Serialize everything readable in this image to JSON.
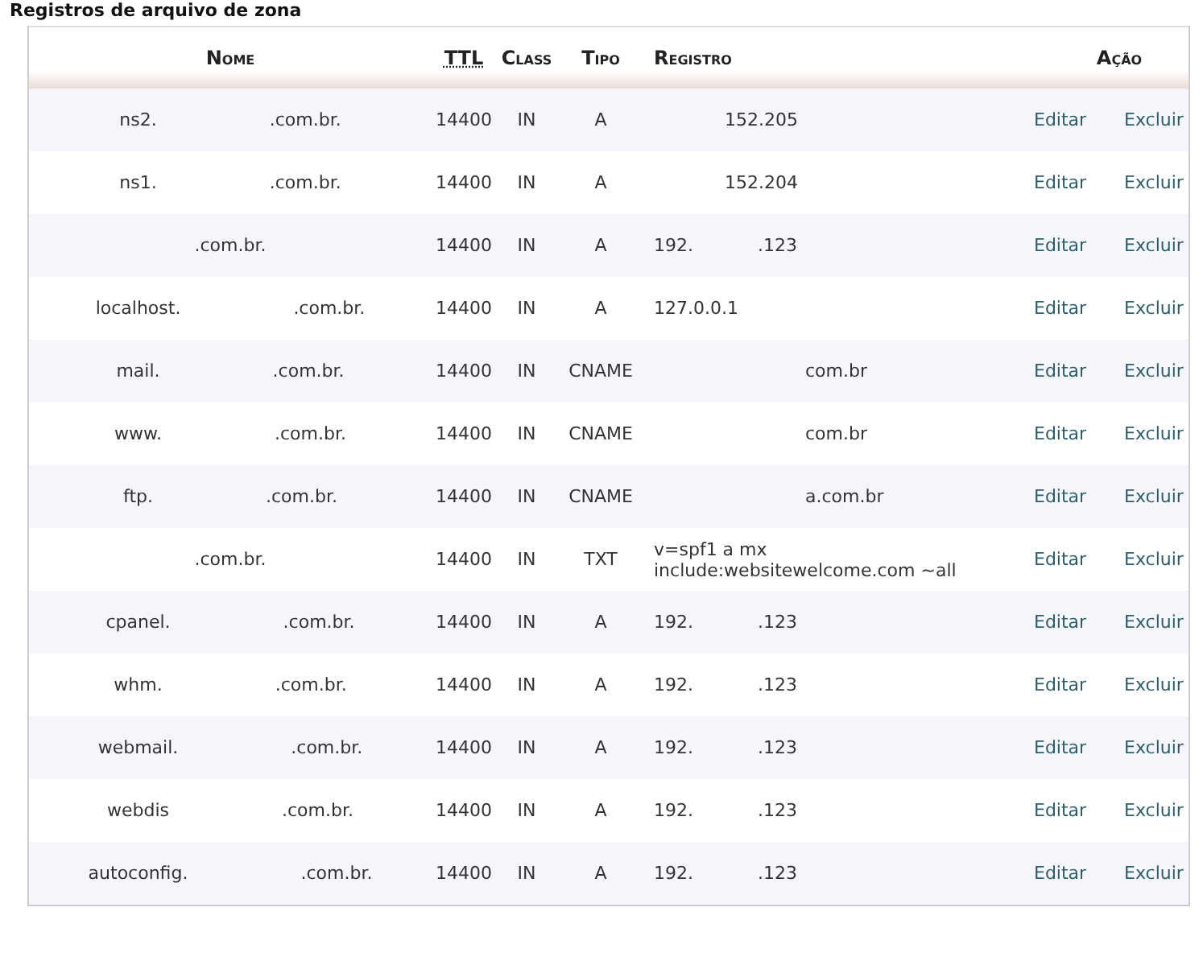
{
  "title": "Registros de arquivo de zona",
  "columns": [
    "Nome",
    "TTL",
    "Class",
    "Tipo",
    "Registro",
    "Ação"
  ],
  "rows": [
    {
      "name": [
        "ns2.",
        ".com.br."
      ],
      "ttl": "14400",
      "class": "IN",
      "type": "A",
      "record": [
        "152.205"
      ],
      "actions": [
        "Editar",
        "Excluir"
      ]
    },
    {
      "name": [
        "ns1.",
        ".com.br."
      ],
      "ttl": "14400",
      "class": "IN",
      "type": "A",
      "record": [
        "152.204"
      ],
      "actions": [
        "Editar",
        "Excluir"
      ]
    },
    {
      "name": [
        ".com.br."
      ],
      "ttl": "14400",
      "class": "IN",
      "type": "A",
      "record": [
        "192.",
        ".123"
      ],
      "actions": [
        "Editar",
        "Excluir"
      ]
    },
    {
      "name": [
        "localhost.",
        ".com.br."
      ],
      "ttl": "14400",
      "class": "IN",
      "type": "A",
      "record": [
        "127.0.0.1"
      ],
      "actions": [
        "Editar",
        "Excluir"
      ]
    },
    {
      "name": [
        "mail.",
        ".com.br."
      ],
      "ttl": "14400",
      "class": "IN",
      "type": "CNAME",
      "record": [
        "com.br"
      ],
      "actions": [
        "Editar",
        "Excluir"
      ]
    },
    {
      "name": [
        "www.",
        ".com.br."
      ],
      "ttl": "14400",
      "class": "IN",
      "type": "CNAME",
      "record": [
        "com.br"
      ],
      "actions": [
        "Editar",
        "Excluir"
      ]
    },
    {
      "name": [
        "ftp.",
        ".com.br."
      ],
      "ttl": "14400",
      "class": "IN",
      "type": "CNAME",
      "record": [
        "a.com.br"
      ],
      "actions": [
        "Editar",
        "Excluir"
      ]
    },
    {
      "name": [
        ".com.br."
      ],
      "ttl": "14400",
      "class": "IN",
      "type": "TXT",
      "record": [
        "v=spf1 a mx include:websitewelcome.com ~all"
      ],
      "actions": [
        "Editar",
        "Excluir"
      ]
    },
    {
      "name": [
        "cpanel.",
        ".com.br."
      ],
      "ttl": "14400",
      "class": "IN",
      "type": "A",
      "record": [
        "192.",
        ".123"
      ],
      "actions": [
        "Editar",
        "Excluir"
      ]
    },
    {
      "name": [
        "whm.",
        ".com.br."
      ],
      "ttl": "14400",
      "class": "IN",
      "type": "A",
      "record": [
        "192.",
        ".123"
      ],
      "actions": [
        "Editar",
        "Excluir"
      ]
    },
    {
      "name": [
        "webmail.",
        ".com.br."
      ],
      "ttl": "14400",
      "class": "IN",
      "type": "A",
      "record": [
        "192.",
        ".123"
      ],
      "actions": [
        "Editar",
        "Excluir"
      ]
    },
    {
      "name": [
        "webdis",
        ".com.br."
      ],
      "ttl": "14400",
      "class": "IN",
      "type": "A",
      "record": [
        "192.",
        ".123"
      ],
      "actions": [
        "Editar",
        "Excluir"
      ]
    },
    {
      "name": [
        "autoconfig.",
        ".com.br."
      ],
      "ttl": "14400",
      "class": "IN",
      "type": "A",
      "record": [
        "192.",
        ".123"
      ],
      "actions": [
        "Editar",
        "Excluir"
      ]
    }
  ]
}
